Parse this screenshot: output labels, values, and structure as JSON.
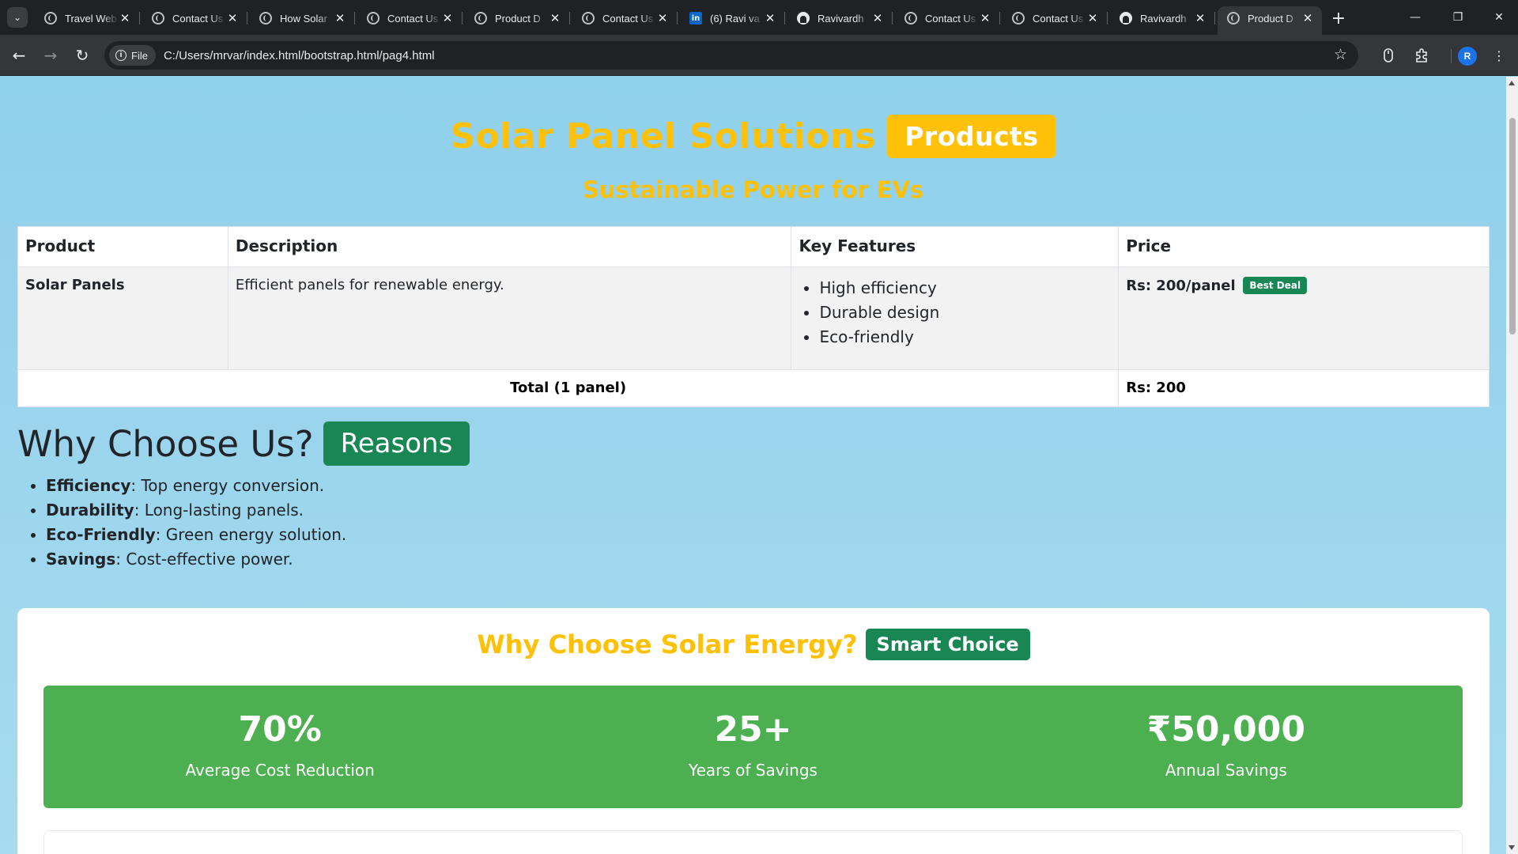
{
  "browser": {
    "tabs": [
      {
        "title": "Travel Web",
        "icon": "globe-icon"
      },
      {
        "title": "Contact Us",
        "icon": "globe-icon"
      },
      {
        "title": "How Solar",
        "icon": "globe-icon"
      },
      {
        "title": "Contact Us",
        "icon": "globe-icon"
      },
      {
        "title": "Product D",
        "icon": "globe-icon"
      },
      {
        "title": "Contact Us",
        "icon": "globe-icon"
      },
      {
        "title": "(6) Ravi va",
        "icon": "linkedin-icon"
      },
      {
        "title": "Ravivardh",
        "icon": "github-icon"
      },
      {
        "title": "Contact Us",
        "icon": "globe-icon"
      },
      {
        "title": "Contact Us",
        "icon": "globe-icon"
      },
      {
        "title": "Ravivardh",
        "icon": "github-icon"
      },
      {
        "title": "Product D",
        "icon": "globe-icon",
        "active": true
      }
    ],
    "chip_label": "File",
    "url": "C:/Users/mrvar/index.html/bootstrap.html/pag4.html",
    "profile_initial": "R",
    "linkedin_glyph": "in"
  },
  "page": {
    "title": "Solar Panel Solutions",
    "title_badge": "Products",
    "subtitle": "Sustainable Power for EVs",
    "table": {
      "headers": [
        "Product",
        "Description",
        "Key Features",
        "Price"
      ],
      "row": {
        "product": "Solar Panels",
        "description": "Efficient panels for renewable energy.",
        "features": [
          "High efficiency",
          "Durable design",
          "Eco-friendly"
        ],
        "price": "Rs: 200/panel",
        "price_badge": "Best Deal"
      },
      "total_label": "Total (1 panel)",
      "total_value": "Rs: 200"
    },
    "why": {
      "title": "Why Choose Us?",
      "badge": "Reasons",
      "reasons": [
        {
          "term": "Efficiency",
          "text": ": Top energy conversion."
        },
        {
          "term": "Durability",
          "text": ": Long-lasting panels."
        },
        {
          "term": "Eco-Friendly",
          "text": ": Green energy solution."
        },
        {
          "term": "Savings",
          "text": ": Cost-effective power."
        }
      ]
    },
    "solar_card": {
      "title": "Why Choose Solar Energy?",
      "badge": "Smart Choice",
      "stats": [
        {
          "value": "70%",
          "label": "Average Cost Reduction"
        },
        {
          "value": "25+",
          "label": "Years of Savings"
        },
        {
          "value": "₹50,000",
          "label": "Annual Savings"
        }
      ]
    }
  },
  "colors": {
    "accent_yellow": "#ffc107",
    "badge_green": "#198754",
    "stats_green": "#4caf50",
    "page_bg": "#8fd0eb"
  }
}
